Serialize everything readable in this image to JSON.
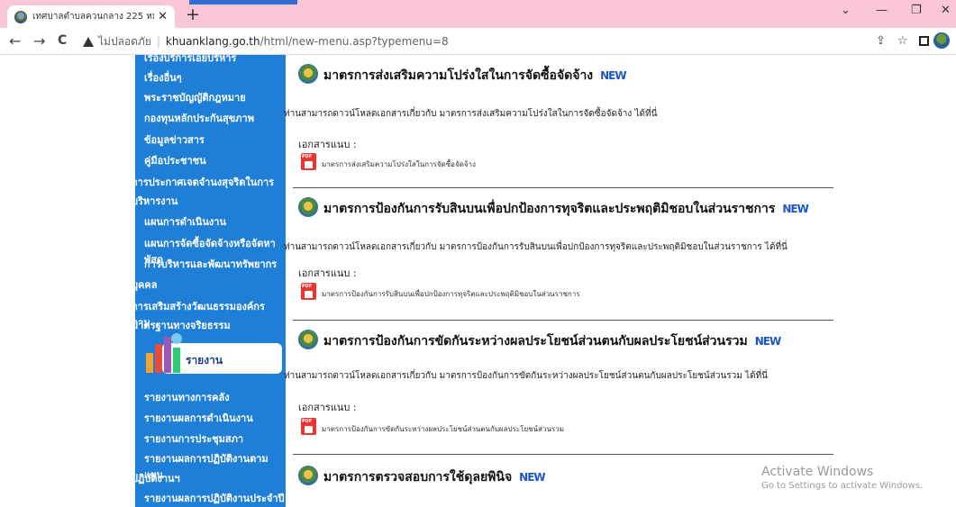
{
  "browser": {
    "tab_title": "เทศบาลตำบลควนกลาง 225 หมู่ที่ 5 ต",
    "tab_close": "✕",
    "new_tab": "+",
    "back": "←",
    "forward": "→",
    "reload": "C",
    "security_label": "ไม่ปลอดภัย",
    "host": "khuanklang.go.th",
    "path": "/html/new-menu.asp?typemenu=8",
    "minimize": "—",
    "maximize": "❐",
    "close": "✕",
    "chevron": "⌄"
  },
  "sidebar": {
    "links_top": [
      "เรื่องอื่นๆ",
      "พระราชบัญญัติกฎหมาย",
      "กองทุนหลักประกันสุขภาพ",
      "ข้อมูลข่าวสาร",
      "คู่มือประชาชน",
      "การประกาศเจตจำนงสุจริตในการ",
      "บริหารงาน",
      "แผนการดำเนินงาน",
      "แผนการจัดซื้อจัดจ้างหรือจัดหาพัสดุ",
      "การบริหารและพัฒนาทรัพยากร",
      "บุคคล",
      "การเสริมสร้างวัฒนธรรมองค์กร ตาม",
      "มาตรฐานทางจริยธรรม"
    ],
    "report_heading": "รายงาน",
    "links_report": [
      "รายงานทางการคลัง",
      "รายงานผลการดำเนินงาน",
      "รายงานการประชุมสภา",
      "รายงานผลการปฏิบัติงานตามแผน",
      "ปฏิบัติงานฯ",
      "รายงานผลการปฏิบัติงานประจำปี"
    ]
  },
  "sections": [
    {
      "title": "มาตรการส่งเสริมความโปร่งใสในการจัดซื้อจัดจ้าง",
      "badge": "NEW",
      "desc": "ท่านสามารถดาวน์โหลดเอกสารเกี่ยวกับ มาตรการส่งเสริมความโปร่งใสในการจัดซื้อจัดจ้าง ได้ที่นี่",
      "attach_label": "เอกสารแนบ :",
      "file": "มาตรการส่งเสริมความโปร่งใสในการจัดซื้อจัดจ้าง"
    },
    {
      "title": "มาตรการป้องกันการรับสินบนเพื่อปกป้องการทุจริตและประพฤติมิชอบในส่วนราชการ",
      "badge": "NEW",
      "desc": "ท่านสามารถดาวน์โหลดเอกสารเกี่ยวกับ มาตรการป้องกันการรับสินบนเพื่อปกป้องการทุจริตและประพฤติมิชอบในส่วนราชการ ได้ที่นี่",
      "attach_label": "เอกสารแนบ :",
      "file": "มาตรการป้องกันการรับสินบนเพื่อปกป้องการทุจริตและประพฤติมิชอบในส่วนราชการ"
    },
    {
      "title": "มาตรการป้องกันการขัดกันระหว่างผลประโยชน์ส่วนตนกับผลประโยชน์ส่วนรวม",
      "badge": "NEW",
      "desc": "ท่านสามารถดาวน์โหลดเอกสารเกี่ยวกับ มาตรการป้องกันการขัดกันระหว่างผลประโยชน์ส่วนตนกับผลประโยชน์ส่วนรวม ได้ที่นี่",
      "attach_label": "เอกสารแนบ :",
      "file": "มาตรการป้องกันการขัดกันระหว่างผลประโยชน์ส่วนตนกับผลประโยชน์ส่วนรวม"
    },
    {
      "title": "มาตรการตรวจสอบการใช้ดุลยพินิจ",
      "badge": "NEW"
    }
  ],
  "watermark": {
    "line1": "Activate Windows",
    "line2": "Go to Settings to activate Windows."
  },
  "colors": {
    "tabstrip": "#f9c6d6",
    "sidebar": "#1f7fd6",
    "badge": "#1b57c9"
  }
}
